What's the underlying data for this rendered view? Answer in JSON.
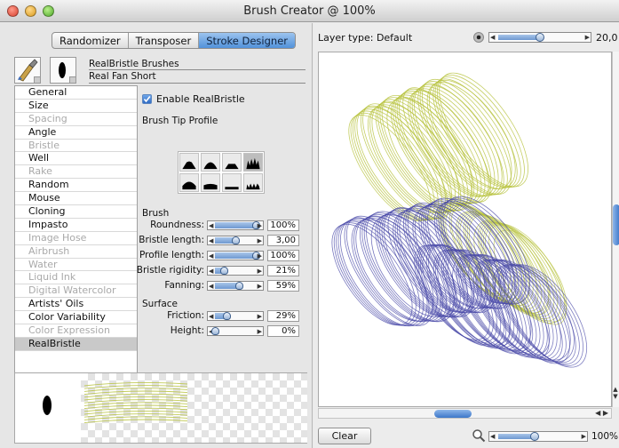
{
  "window": {
    "title": "Brush Creator @ 100%"
  },
  "tabs": [
    {
      "label": "Randomizer",
      "active": false
    },
    {
      "label": "Transposer",
      "active": false
    },
    {
      "label": "Stroke Designer",
      "active": true
    }
  ],
  "brush": {
    "category": "RealBristle Brushes",
    "variant": "Real Fan Short"
  },
  "categories": [
    {
      "label": "General",
      "enabled": true
    },
    {
      "label": "Size",
      "enabled": true
    },
    {
      "label": "Spacing",
      "enabled": false
    },
    {
      "label": "Angle",
      "enabled": true
    },
    {
      "label": "Bristle",
      "enabled": false
    },
    {
      "label": "Well",
      "enabled": true
    },
    {
      "label": "Rake",
      "enabled": false
    },
    {
      "label": "Random",
      "enabled": true
    },
    {
      "label": "Mouse",
      "enabled": true
    },
    {
      "label": "Cloning",
      "enabled": true
    },
    {
      "label": "Impasto",
      "enabled": true
    },
    {
      "label": "Image Hose",
      "enabled": false
    },
    {
      "label": "Airbrush",
      "enabled": false
    },
    {
      "label": "Water",
      "enabled": false
    },
    {
      "label": "Liquid Ink",
      "enabled": false
    },
    {
      "label": "Digital Watercolor",
      "enabled": false
    },
    {
      "label": "Artists' Oils",
      "enabled": true
    },
    {
      "label": "Color Variability",
      "enabled": true
    },
    {
      "label": "Color Expression",
      "enabled": false
    },
    {
      "label": "RealBristle",
      "enabled": true,
      "selected": true
    }
  ],
  "panel": {
    "enable_label": "Enable RealBristle",
    "enable_checked": true,
    "tip_profile_label": "Brush Tip Profile",
    "selected_tip_index": 3,
    "brush_section": "Brush",
    "surface_section": "Surface"
  },
  "brush_params": [
    {
      "label": "Roundness:",
      "value": "100%",
      "level": 1.0
    },
    {
      "label": "Bristle length:",
      "value": "3,00",
      "level": 0.5
    },
    {
      "label": "Profile length:",
      "value": "100%",
      "level": 1.0
    },
    {
      "label": "Bristle rigidity:",
      "value": "21%",
      "level": 0.21
    },
    {
      "label": "Fanning:",
      "value": "59%",
      "level": 0.59
    }
  ],
  "surface_params": [
    {
      "label": "Friction:",
      "value": "29%",
      "level": 0.29
    },
    {
      "label": "Height:",
      "value": "0%",
      "level": 0.0
    }
  ],
  "canvas_header": {
    "layer_type": "Layer type: Default",
    "size_value": "20,0",
    "size_level": 0.5
  },
  "footer": {
    "clear_label": "Clear",
    "zoom_value": "100%",
    "zoom_level": 0.45
  },
  "colors": {
    "stroke_green": "#b7c23c",
    "stroke_blue": "#4a4aa8",
    "accent": "#4d8fd9"
  }
}
